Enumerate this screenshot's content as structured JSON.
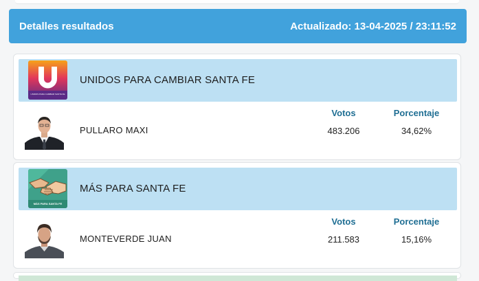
{
  "header": {
    "title": "Detalles resultados",
    "updated": "Actualizado: 13-04-2025 / 23:11:52"
  },
  "columns": {
    "votes": "Votos",
    "percent": "Porcentaje"
  },
  "results": [
    {
      "party": "UNIDOS PARA CAMBIAR SANTA FE",
      "logo_icon": "unidos-logo-icon",
      "logo_text": "UNIDOS PARA CAMBIAR SANTA FE",
      "candidate": "PULLARO MAXI",
      "votes": "483.206",
      "percent": "34,62%"
    },
    {
      "party": "MÁS PARA SANTA FE",
      "logo_icon": "handshake-logo-icon",
      "logo_text": "MÁS PARA SANTA FE",
      "candidate": "MONTEVERDE JUAN",
      "votes": "211.583",
      "percent": "15,16%"
    }
  ],
  "colors": {
    "header_bg": "#41a2dc",
    "party_bg": "#bde0f3",
    "column_head": "#1f6e93"
  }
}
